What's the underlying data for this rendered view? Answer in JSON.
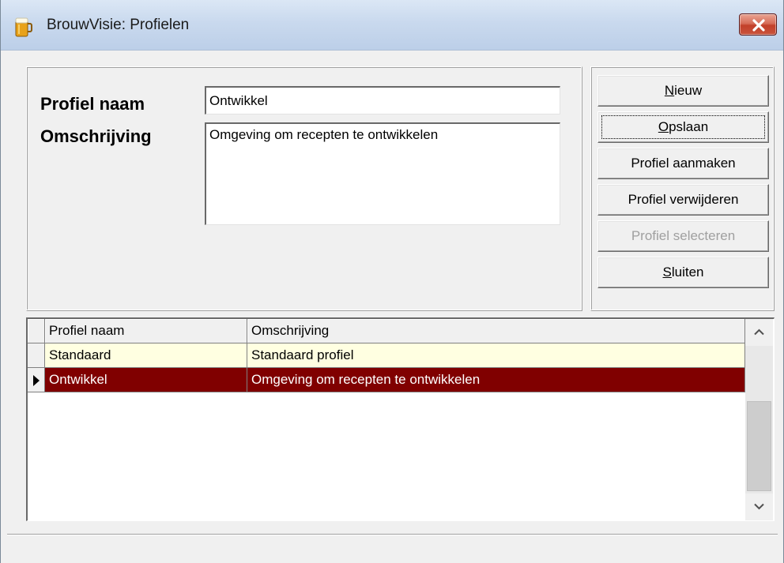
{
  "window": {
    "title": "BrouwVisie: Profielen"
  },
  "form": {
    "profiel_naam_label": "Profiel naam",
    "omschrijving_label": "Omschrijving",
    "profiel_naam_value": "Ontwikkel",
    "omschrijving_value": "Omgeving om recepten te ontwikkelen"
  },
  "buttons": {
    "nieuw": {
      "accel": "N",
      "rest": "ieuw",
      "enabled": true
    },
    "opslaan": {
      "accel": "O",
      "rest": "pslaan",
      "enabled": true,
      "focused": true
    },
    "aanmaken": {
      "label": "Profiel aanmaken",
      "enabled": true
    },
    "verwijderen": {
      "label": "Profiel verwijderen",
      "enabled": true
    },
    "selecteren": {
      "label": "Profiel selecteren",
      "enabled": false
    },
    "sluiten": {
      "accel": "S",
      "rest": "luiten",
      "enabled": true
    }
  },
  "grid": {
    "columns": [
      "Profiel naam",
      "Omschrijving"
    ],
    "rows": [
      {
        "naam": "Standaard",
        "omschrijving": "Standaard profiel",
        "selected": false
      },
      {
        "naam": "Ontwikkel",
        "omschrijving": "Omgeving om recepten te ontwikkelen",
        "selected": true
      }
    ]
  },
  "colors": {
    "selected_row_bg": "#800000",
    "row_bg": "#ffffe1"
  },
  "icons": {
    "app": "beer-glass-icon",
    "close": "close-icon",
    "row_indicator": "triangle-right-icon",
    "scroll_up": "chevron-up-icon",
    "scroll_down": "chevron-down-icon"
  }
}
